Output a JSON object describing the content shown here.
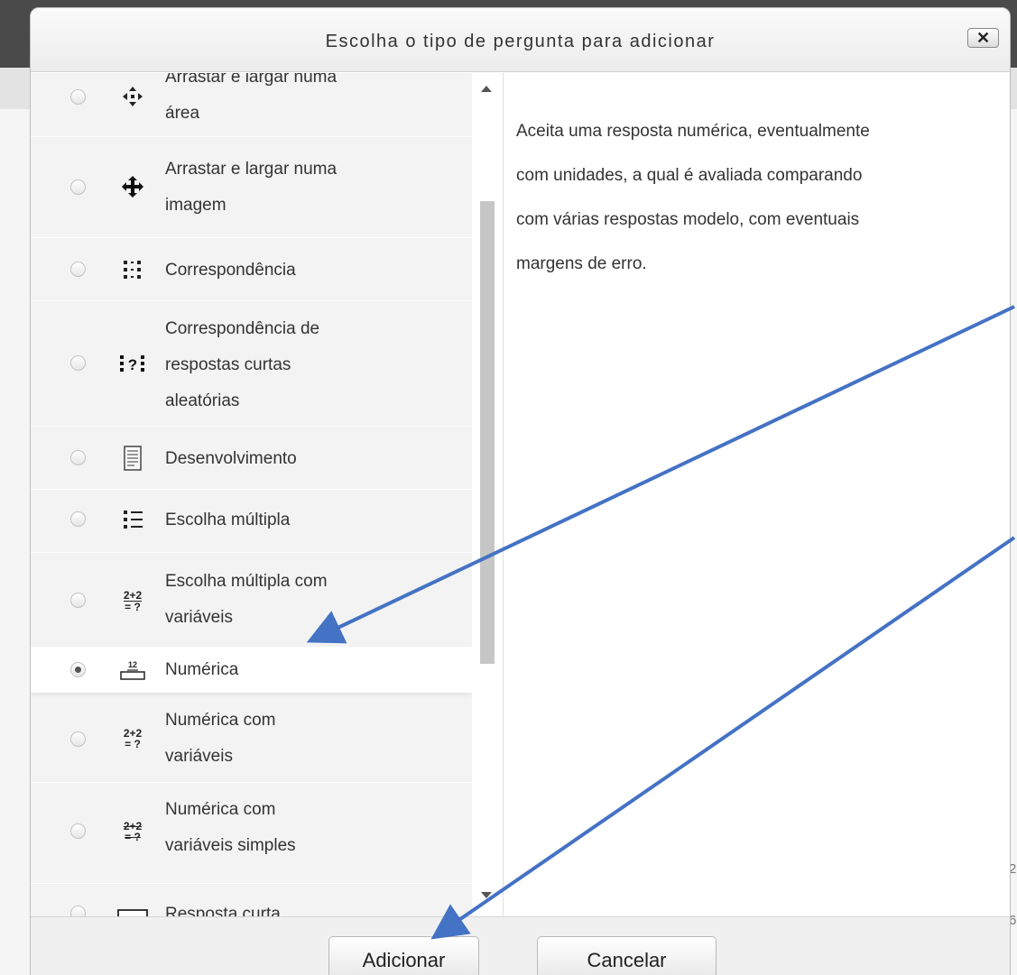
{
  "dialog": {
    "title": "Escolha o tipo de pergunta para adicionar",
    "close_label": "✕"
  },
  "options": [
    {
      "label_lines": [
        "Arrastar e largar numa",
        "área"
      ],
      "icon": "move-arrows-icon",
      "selected": false
    },
    {
      "label_lines": [
        "Arrastar e largar numa",
        "imagem"
      ],
      "icon": "move-cross-icon",
      "selected": false
    },
    {
      "label_lines": [
        "Correspondência"
      ],
      "icon": "matching-grid-icon",
      "selected": false
    },
    {
      "label_lines": [
        "Correspondência de",
        "respostas curtas",
        "aleatórias"
      ],
      "icon": "random-matching-icon",
      "selected": false
    },
    {
      "label_lines": [
        "Desenvolvimento"
      ],
      "icon": "essay-document-icon",
      "selected": false
    },
    {
      "label_lines": [
        "Escolha múltipla"
      ],
      "icon": "multichoice-list-icon",
      "selected": false
    },
    {
      "label_lines": [
        "Escolha múltipla com",
        "variáveis"
      ],
      "icon": "calculated-multichoice-icon",
      "selected": false
    },
    {
      "label_lines": [
        "Numérica"
      ],
      "icon": "numerical-icon",
      "selected": true
    },
    {
      "label_lines": [
        "Numérica com",
        "variáveis"
      ],
      "icon": "calculated-icon",
      "selected": false
    },
    {
      "label_lines": [
        "Numérica com",
        "variáveis simples"
      ],
      "icon": "calculated-simple-icon",
      "selected": false
    },
    {
      "label_lines": [
        "Resposta curta"
      ],
      "icon": "short-answer-icon",
      "selected": false
    }
  ],
  "icon_glyphs": {
    "calc_top": "2+2",
    "calc_bottom": "= ?",
    "numerical_num": "12",
    "random_matching": "?"
  },
  "description": [
    "Aceita uma resposta numérica, eventualmente",
    "com unidades, a qual é avaliada comparando",
    "com várias respostas modelo, com eventuais",
    "margens de erro."
  ],
  "buttons": {
    "add": "Adicionar",
    "cancel": "Cancelar"
  },
  "background": {
    "edge_digits": [
      "2",
      "6"
    ]
  },
  "colors": {
    "annotation_arrow": "#4472c4",
    "selected_row": "#ffffff",
    "list_background": "#f3f3f3"
  }
}
